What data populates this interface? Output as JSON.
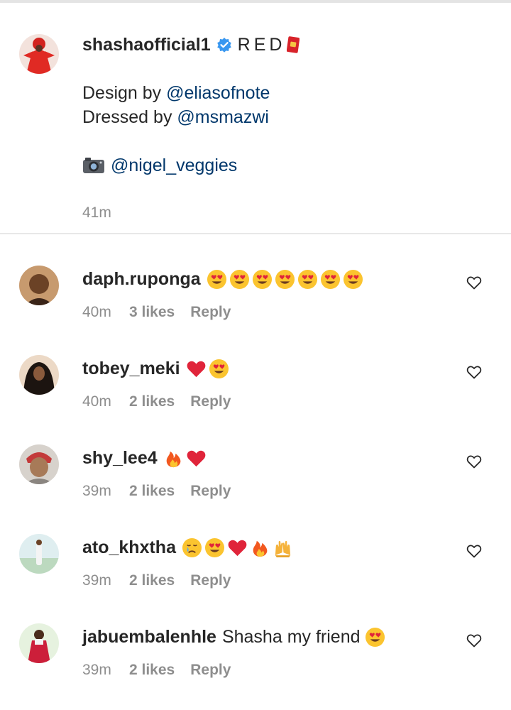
{
  "caption": {
    "username": "shashaofficial1",
    "title": "RED",
    "lines": [
      "Design by ",
      "@eliasofnote",
      "Dressed by ",
      "@msmazwi",
      "@nigel_veggies"
    ],
    "time": "41m",
    "icons": [
      "verified-badge-icon",
      "red-envelope-icon",
      "camera-icon"
    ]
  },
  "comments": [
    {
      "username": "daph.ruponga",
      "text": "",
      "emojis": [
        "heart-eyes",
        "heart-eyes",
        "heart-eyes",
        "heart-eyes",
        "heart-eyes",
        "heart-eyes",
        "heart-eyes"
      ],
      "time": "40m",
      "likes": "3 likes",
      "reply": "Reply"
    },
    {
      "username": "tobey_meki",
      "text": "",
      "emojis": [
        "red-heart",
        "heart-eyes"
      ],
      "time": "40m",
      "likes": "2 likes",
      "reply": "Reply"
    },
    {
      "username": "shy_lee4",
      "text": "",
      "emojis": [
        "fire",
        "red-heart"
      ],
      "time": "39m",
      "likes": "2 likes",
      "reply": "Reply"
    },
    {
      "username": "ato_khxtha",
      "text": "",
      "emojis": [
        "crying",
        "heart-eyes",
        "red-heart",
        "fire",
        "raised-hands"
      ],
      "time": "39m",
      "likes": "2 likes",
      "reply": "Reply"
    },
    {
      "username": "jabuembalenhle",
      "text": "Shasha my friend",
      "emojis": [
        "heart-eyes"
      ],
      "time": "39m",
      "likes": "2 likes",
      "reply": "Reply"
    }
  ],
  "colors": {
    "mention": "#00376b",
    "meta": "#8e8e8e",
    "verified": "#3897f0",
    "heart": "#e0243a"
  }
}
